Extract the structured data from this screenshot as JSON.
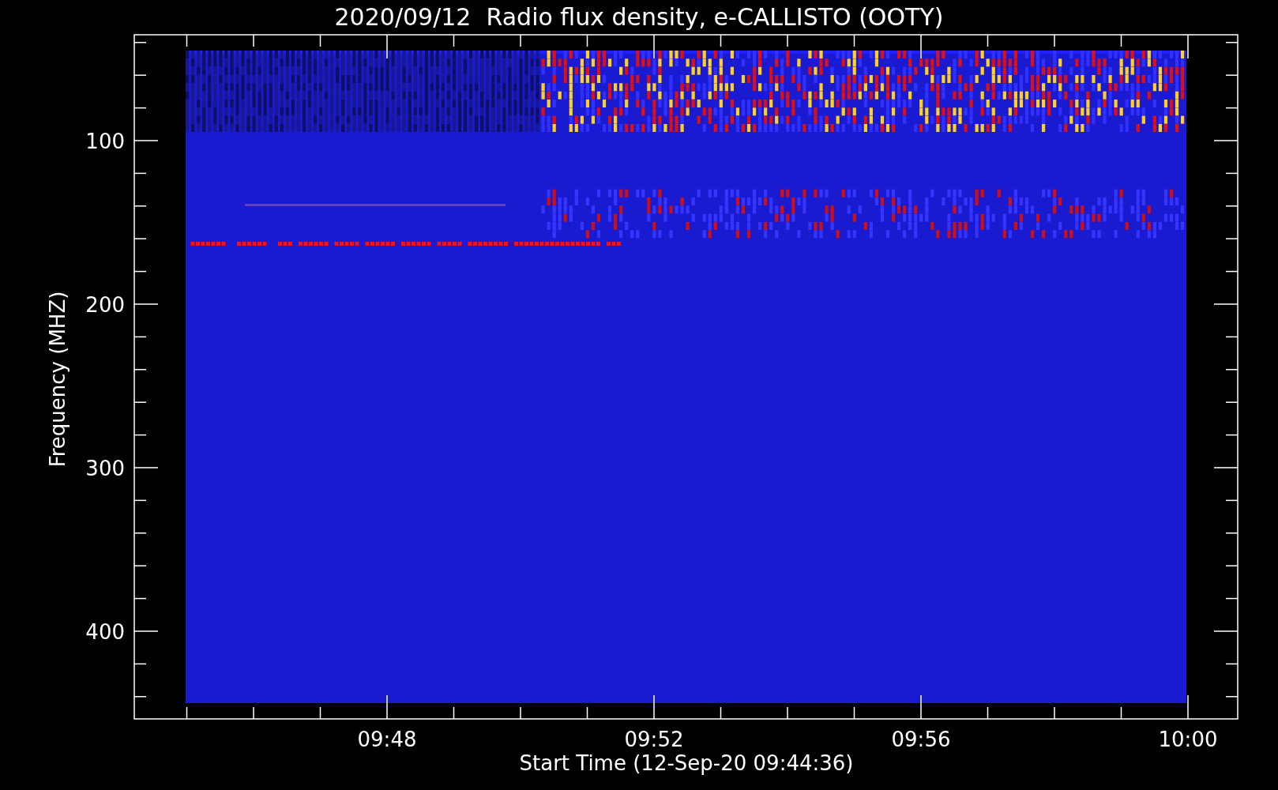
{
  "plot": {
    "title": "2020/09/12  Radio flux density, e-CALLISTO (OOTY)",
    "ylabel": "Frequency (MHZ)",
    "xlabel": "Start Time (12-Sep-20 09:44:36)",
    "y_tick_labels": [
      "100",
      "200",
      "300",
      "400"
    ],
    "x_tick_labels": [
      "09:48",
      "09:52",
      "09:56",
      "10:00"
    ]
  }
}
